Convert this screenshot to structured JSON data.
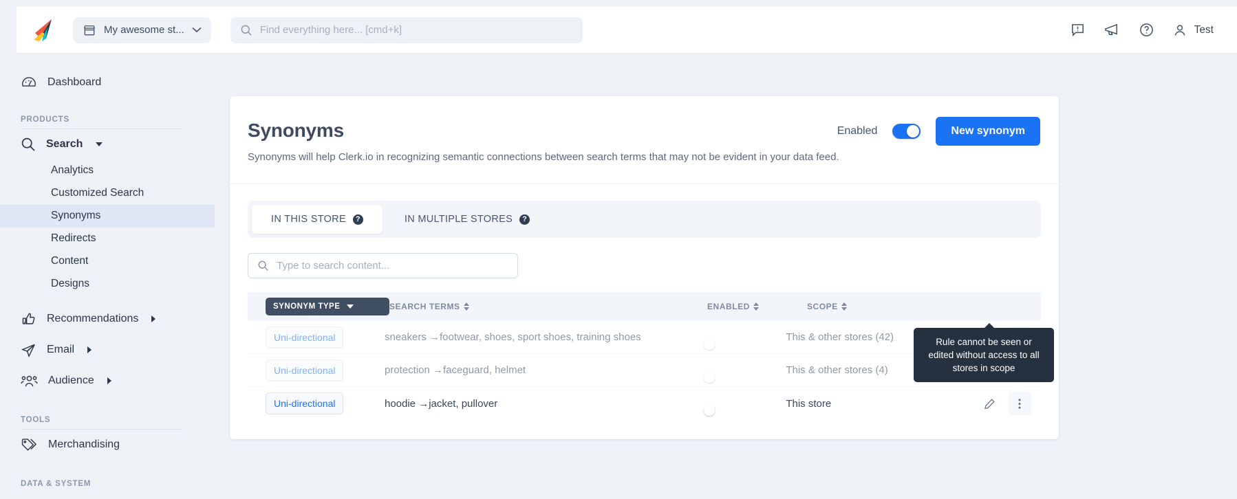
{
  "topbar": {
    "logo_name": "clerk-logo",
    "store": {
      "label": "My awesome st...",
      "icon": "store-icon"
    },
    "search": {
      "value": "",
      "placeholder": "Find everything here... [cmd+k]"
    },
    "icons": [
      {
        "name": "feedback-icon",
        "glyph": "!"
      },
      {
        "name": "megaphone-icon",
        "glyph": ""
      },
      {
        "name": "help-icon",
        "glyph": "?"
      }
    ],
    "user": {
      "name": "Test",
      "icon": "user-icon"
    }
  },
  "sidebar": {
    "dashboard": {
      "label": "Dashboard",
      "icon": "dashboard-icon"
    },
    "sections": [
      {
        "label": "PRODUCTS"
      },
      {
        "label": "TOOLS"
      },
      {
        "label": "DATA & SYSTEM"
      }
    ],
    "search_group": {
      "label": "Search",
      "icon": "search-icon",
      "expanded": true,
      "items": [
        {
          "label": "Analytics",
          "selected": false
        },
        {
          "label": "Customized Search",
          "selected": false
        },
        {
          "label": "Synonyms",
          "selected": true
        },
        {
          "label": "Redirects",
          "selected": false
        },
        {
          "label": "Content",
          "selected": false
        },
        {
          "label": "Designs",
          "selected": false
        }
      ]
    },
    "groups": [
      {
        "label": "Recommendations",
        "icon": "thumbs-up-icon"
      },
      {
        "label": "Email",
        "icon": "paper-plane-icon"
      },
      {
        "label": "Audience",
        "icon": "people-icon"
      }
    ],
    "tools": [
      {
        "label": "Merchandising",
        "icon": "tag-icon"
      }
    ]
  },
  "main": {
    "title": "Synonyms",
    "subtitle": "Synonyms will help Clerk.io in recognizing semantic connections between search terms that may not be evident in your data feed.",
    "enabled_label": "Enabled",
    "enabled_value": true,
    "new_button": "New synonym",
    "tabs": [
      {
        "label": "IN THIS STORE",
        "active": true,
        "help": "?"
      },
      {
        "label": "IN MULTIPLE STORES",
        "active": false,
        "help": "?"
      }
    ],
    "content_search": {
      "value": "",
      "placeholder": "Type to search content..."
    },
    "table": {
      "columns": [
        {
          "key": "type",
          "label": "SYNONYM TYPE",
          "style": "chip",
          "sortable": true
        },
        {
          "key": "terms",
          "label": "SEARCH TERMS",
          "style": "plain",
          "sortable": true
        },
        {
          "key": "enabled",
          "label": "ENABLED",
          "style": "plain",
          "sortable": true
        },
        {
          "key": "scope",
          "label": "SCOPE",
          "style": "plain",
          "sortable": true
        }
      ],
      "rows": [
        {
          "type": "Uni-directional",
          "terms": "sneakers →footwear, shoes, sport shoes, training shoes",
          "enabled": true,
          "scope": "This & other stores (42)",
          "dimmed": true
        },
        {
          "type": "Uni-directional",
          "terms": "protection →faceguard, helmet",
          "enabled": true,
          "scope": "This & other stores (4)",
          "dimmed": true
        },
        {
          "type": "Uni-directional",
          "terms": "hoodie →jacket, pullover",
          "enabled": true,
          "scope": "This store",
          "dimmed": false
        }
      ],
      "row_actions": [
        {
          "name": "edit-row-button",
          "icon": "pencil-icon"
        },
        {
          "name": "row-menu-button",
          "icon": "kebab-menu-icon"
        }
      ]
    }
  },
  "tooltip": {
    "text": "Rule cannot be seen or edited without access to all stores in scope"
  },
  "colors": {
    "accent": "#1a73f5",
    "page_bg": "#eef2f7",
    "card_bg": "#ffffff",
    "text": "#39465c",
    "muted": "#7d8aa0",
    "tooltip_bg": "#26313f",
    "chip_bg": "#3f4e63"
  }
}
